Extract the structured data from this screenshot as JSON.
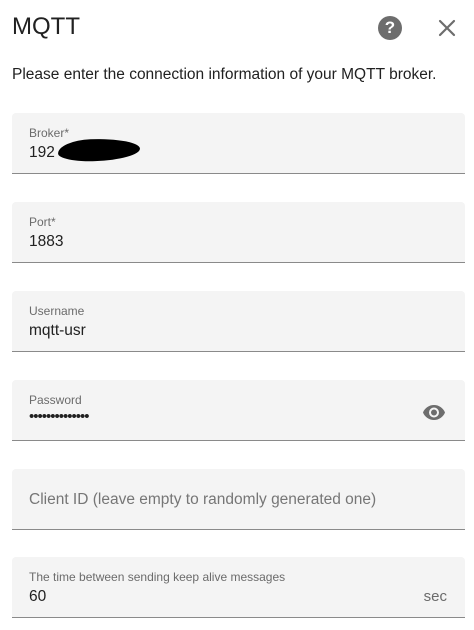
{
  "dialog": {
    "title": "MQTT",
    "help_icon": "question-circle-icon",
    "close_icon": "close-icon",
    "description": "Please enter the connection information of your MQTT broker."
  },
  "fields": {
    "broker": {
      "label": "Broker*",
      "value": "192"
    },
    "port": {
      "label": "Port*",
      "value": "1883"
    },
    "username": {
      "label": "Username",
      "value": "mqtt-usr"
    },
    "password": {
      "label": "Password",
      "value": "••••••••••••••",
      "toggle_icon": "eye-icon"
    },
    "client_id": {
      "placeholder": "Client ID (leave empty to randomly generated one)"
    },
    "keepalive": {
      "label": "The time between sending keep alive messages",
      "value": "60",
      "suffix": "sec"
    }
  },
  "colors": {
    "field_background": "#f4f4f4",
    "text": "#212121",
    "label": "#6b6b6b",
    "icon": "#6d6d6d"
  }
}
